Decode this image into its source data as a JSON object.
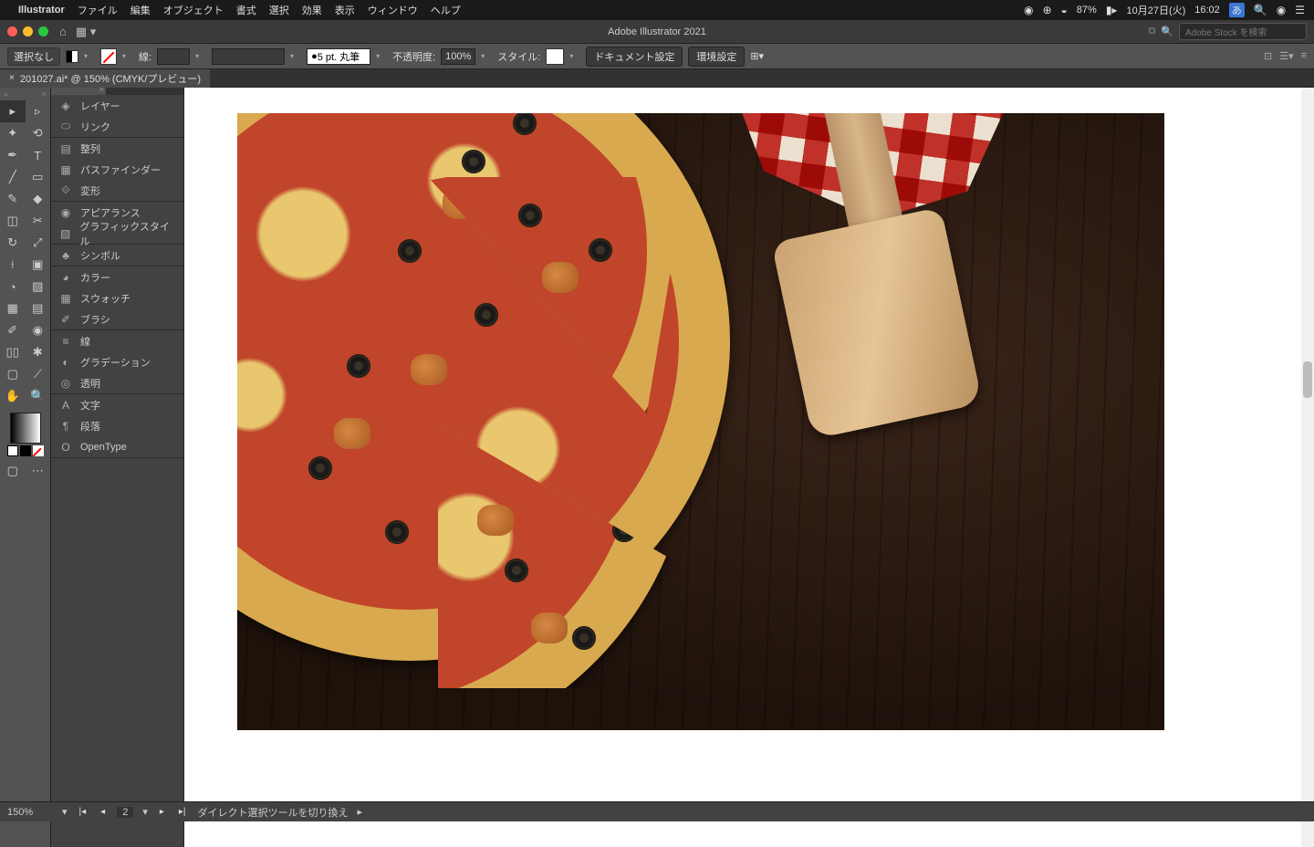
{
  "menubar": {
    "app": "Illustrator",
    "items": [
      "ファイル",
      "編集",
      "オブジェクト",
      "書式",
      "選択",
      "効果",
      "表示",
      "ウィンドウ",
      "ヘルプ"
    ],
    "battery": "87%",
    "date": "10月27日(火)",
    "time": "16:02",
    "ime": "あ"
  },
  "titlebar": {
    "title": "Adobe Illustrator 2021",
    "search_ph": "Adobe Stock を検索"
  },
  "controlbar": {
    "no_selection": "選択なし",
    "stroke_label": "線:",
    "stroke_profile": "5 pt. 丸筆",
    "opacity_label": "不透明度:",
    "opacity_value": "100%",
    "style_label": "スタイル:",
    "doc_setup": "ドキュメント設定",
    "prefs": "環境設定"
  },
  "tab": {
    "label": "201027.ai* @ 150% (CMYK/プレビュー)"
  },
  "panels": [
    [
      "レイヤー",
      "リンク"
    ],
    [
      "整列",
      "パスファインダー",
      "変形"
    ],
    [
      "アピアランス",
      "グラフィックスタイル"
    ],
    [
      "シンボル"
    ],
    [
      "カラー",
      "スウォッチ",
      "ブラシ"
    ],
    [
      "線",
      "グラデーション",
      "透明"
    ],
    [
      "文字",
      "段落",
      "OpenType"
    ]
  ],
  "panel_icons": [
    [
      "◈",
      "⬭"
    ],
    [
      "▤",
      "▦",
      "⟐"
    ],
    [
      "◉",
      "▧"
    ],
    [
      "♣"
    ],
    [
      "◕",
      "▦",
      "✐"
    ],
    [
      "≡",
      "◐",
      "◎"
    ],
    [
      "A",
      "¶",
      "O"
    ]
  ],
  "status": {
    "zoom": "150%",
    "artboard": "2",
    "tool_tip": "ダイレクト選択ツールを切り換え"
  }
}
